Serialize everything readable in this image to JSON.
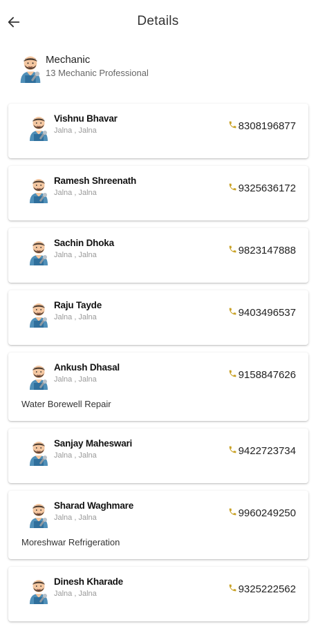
{
  "header": {
    "title": "Details"
  },
  "category": {
    "name": "Mechanic",
    "count_label": "13 Mechanic Professional"
  },
  "workers": [
    {
      "name": "Vishnu Bhavar",
      "location": "Jalna , Jalna",
      "phone": "8308196877",
      "extra": ""
    },
    {
      "name": "Ramesh Shreenath",
      "location": "Jalna , Jalna",
      "phone": "9325636172",
      "extra": ""
    },
    {
      "name": "Sachin Dhoka",
      "location": "Jalna , Jalna",
      "phone": "9823147888",
      "extra": ""
    },
    {
      "name": "Raju Tayde",
      "location": "Jalna , Jalna",
      "phone": "9403496537",
      "extra": ""
    },
    {
      "name": "Ankush Dhasal",
      "location": "Jalna , Jalna",
      "phone": "9158847626",
      "extra": "Water Borewell Repair"
    },
    {
      "name": "Sanjay Maheswari",
      "location": "Jalna , Jalna",
      "phone": "9422723734",
      "extra": ""
    },
    {
      "name": "Sharad Waghmare",
      "location": "Jalna , Jalna",
      "phone": "9960249250",
      "extra": "Moreshwar Refrigeration"
    },
    {
      "name": "Dinesh Kharade",
      "location": "Jalna , Jalna",
      "phone": "9325222562",
      "extra": ""
    }
  ],
  "icons": {
    "back": "arrow-left-icon",
    "avatar": "mechanic-avatar-icon",
    "phone": "phone-icon"
  },
  "colors": {
    "phone_icon": "#c9a227",
    "secondary_text": "#999999"
  }
}
